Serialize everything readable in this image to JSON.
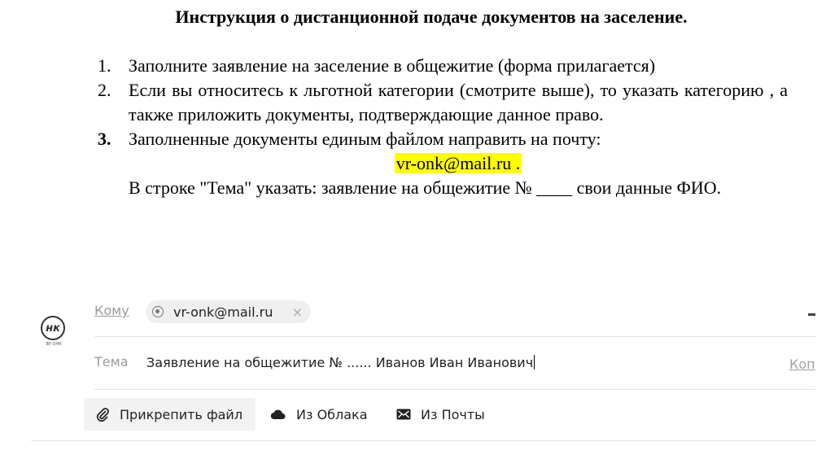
{
  "document": {
    "title": "Инструкция о дистанционной подаче документов на заселение.",
    "steps": [
      {
        "num": "1.",
        "text": "Заполните заявление на заселение в общежитие (форма прилагается)"
      },
      {
        "num": "2.",
        "text": "Если вы относитесь к льготной категории (смотрите выше), то указать категорию , а также приложить документы, подтверждающие данное право."
      },
      {
        "num": "3.",
        "text": "Заполненные документы единым файлом направить на почту:",
        "email": "vr-onk@mail.ru .",
        "subject_note": "В строке \"Тема\" указать:  заявление на общежитие № ____ свои данные ФИО."
      }
    ]
  },
  "composer": {
    "logo_text": "нк",
    "logo_caption": "ВР ОНК",
    "to_label": "Кому",
    "recipient": "vr-onk@mail.ru",
    "recipient_close": "×",
    "subject_label": "Тема",
    "subject_value": "Заявление на общежитие № ...... Иванов Иван Иванович",
    "copy_link": "Коп",
    "attach_label": "Прикрепить файл",
    "cloud_label": "Из Облака",
    "mail_label": "Из Почты"
  },
  "colors": {
    "highlight": "#ffff00",
    "muted": "#9a9a9a",
    "button_bg": "#f2f2f2"
  }
}
